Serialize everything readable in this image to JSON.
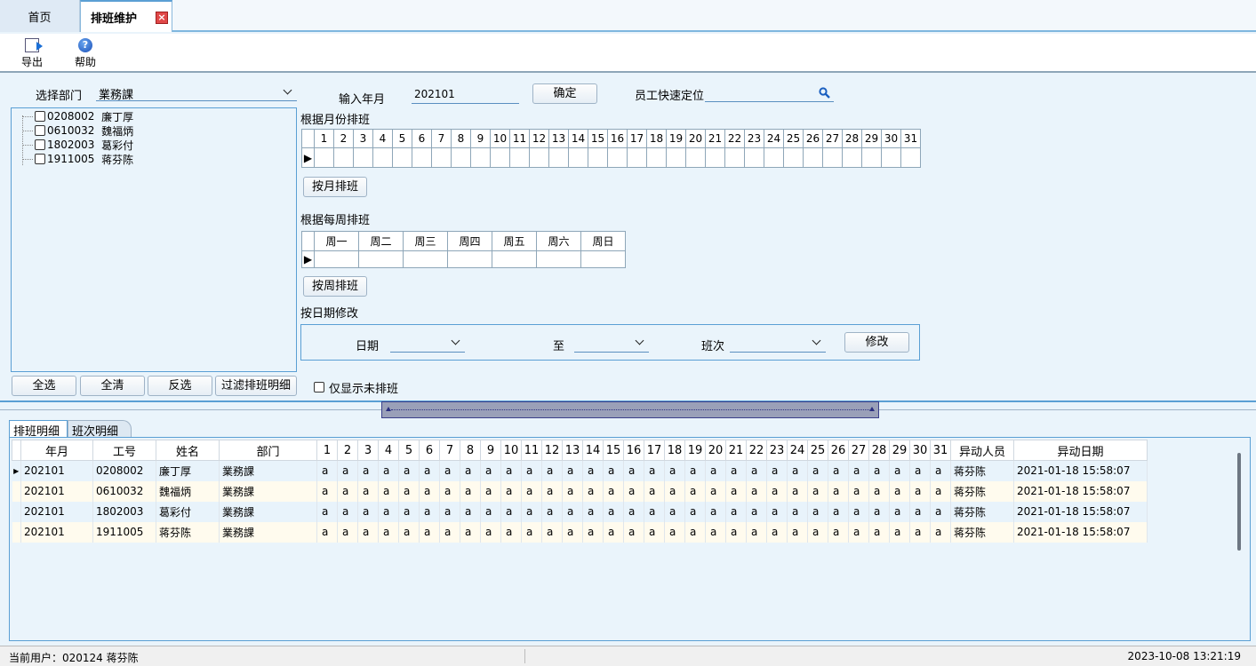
{
  "tabs": {
    "home": "首页",
    "active": "排班维护",
    "close": "×"
  },
  "toolbar": {
    "export_label": "导出",
    "help_label": "帮助",
    "help_glyph": "?"
  },
  "filter": {
    "dept_label": "选择部门",
    "dept_value": "業務課",
    "month_label": "输入年月",
    "month_value": "202101",
    "confirm_label": "确定",
    "locate_label": "员工快速定位",
    "locate_value": ""
  },
  "tree": {
    "items": [
      {
        "code": "0208002",
        "name": "廉丁厚"
      },
      {
        "code": "0610032",
        "name": "魏福炳"
      },
      {
        "code": "1802003",
        "name": "葛彩付"
      },
      {
        "code": "1911005",
        "name": "蒋芬陈"
      }
    ]
  },
  "left_buttons": {
    "select_all": "全选",
    "clear_all": "全清",
    "invert": "反选",
    "filter": "过滤排班明细"
  },
  "only_unscheduled_label": "仅显示未排班",
  "by_month": {
    "title": "根据月份排班",
    "days": [
      "1",
      "2",
      "3",
      "4",
      "5",
      "6",
      "7",
      "8",
      "9",
      "10",
      "11",
      "12",
      "13",
      "14",
      "15",
      "16",
      "17",
      "18",
      "19",
      "20",
      "21",
      "22",
      "23",
      "24",
      "25",
      "26",
      "27",
      "28",
      "29",
      "30",
      "31"
    ],
    "button": "按月排班"
  },
  "by_week": {
    "title": "根据每周排班",
    "days": [
      "周一",
      "周二",
      "周三",
      "周四",
      "周五",
      "周六",
      "周日"
    ],
    "button": "按周排班"
  },
  "by_date": {
    "title": "按日期修改",
    "date_label": "日期",
    "to_label": "至",
    "shift_label": "班次",
    "modify_button": "修改"
  },
  "bottom_tabs": {
    "detail": "排班明细",
    "shift": "班次明细"
  },
  "detail": {
    "columns": {
      "ym": "年月",
      "code": "工号",
      "name": "姓名",
      "dept": "部门",
      "days": [
        "1",
        "2",
        "3",
        "4",
        "5",
        "6",
        "7",
        "8",
        "9",
        "10",
        "11",
        "12",
        "13",
        "14",
        "15",
        "16",
        "17",
        "18",
        "19",
        "20",
        "21",
        "22",
        "23",
        "24",
        "25",
        "26",
        "27",
        "28",
        "29",
        "30",
        "31"
      ],
      "changer": "异动人员",
      "change_date": "异动日期"
    },
    "rows": [
      {
        "ym": "202101",
        "code": "0208002",
        "name": "廉丁厚",
        "dept": "業務課",
        "shift": "a",
        "changer": "蒋芬陈",
        "change_date": "2021-01-18 15:58:07"
      },
      {
        "ym": "202101",
        "code": "0610032",
        "name": "魏福炳",
        "dept": "業務課",
        "shift": "a",
        "changer": "蒋芬陈",
        "change_date": "2021-01-18 15:58:07"
      },
      {
        "ym": "202101",
        "code": "1802003",
        "name": "葛彩付",
        "dept": "業務課",
        "shift": "a",
        "changer": "蒋芬陈",
        "change_date": "2021-01-18 15:58:07"
      },
      {
        "ym": "202101",
        "code": "1911005",
        "name": "蒋芬陈",
        "dept": "業務課",
        "shift": "a",
        "changer": "蒋芬陈",
        "change_date": "2021-01-18 15:58:07"
      }
    ]
  },
  "status": {
    "user": "当前用户：020124  蒋芬陈",
    "datetime": "2023-10-08 13:21:19"
  },
  "colors": {
    "accent": "#5a9fd4",
    "panel": "#eaf4fb",
    "row_alt": "#fffbee",
    "close_red": "#e04848"
  }
}
